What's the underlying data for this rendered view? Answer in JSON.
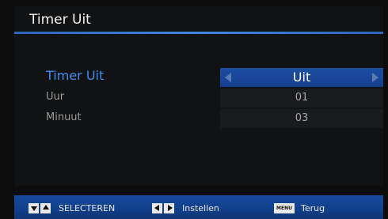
{
  "window": {
    "title": "Timer Uit"
  },
  "settings": [
    {
      "label": "Timer Uit",
      "value": "Uit",
      "selected": true
    },
    {
      "label": "Uur",
      "value": "01",
      "selected": false
    },
    {
      "label": "Minuut",
      "value": "03",
      "selected": false
    }
  ],
  "footer": {
    "select_keys_icons": [
      "down-arrow-key-icon",
      "up-arrow-key-icon"
    ],
    "select_label": "SELECTEREN",
    "adjust_keys_icons": [
      "left-arrow-key-icon",
      "right-arrow-key-icon"
    ],
    "adjust_label": "Instellen",
    "menu_key_label": "MENU",
    "back_label": "Terug"
  },
  "colors": {
    "accent_blue": "#3a8cf2",
    "selected_row_bg": "#1a469a",
    "footer_bg": "#12408a",
    "panel_bg": "#111214"
  }
}
